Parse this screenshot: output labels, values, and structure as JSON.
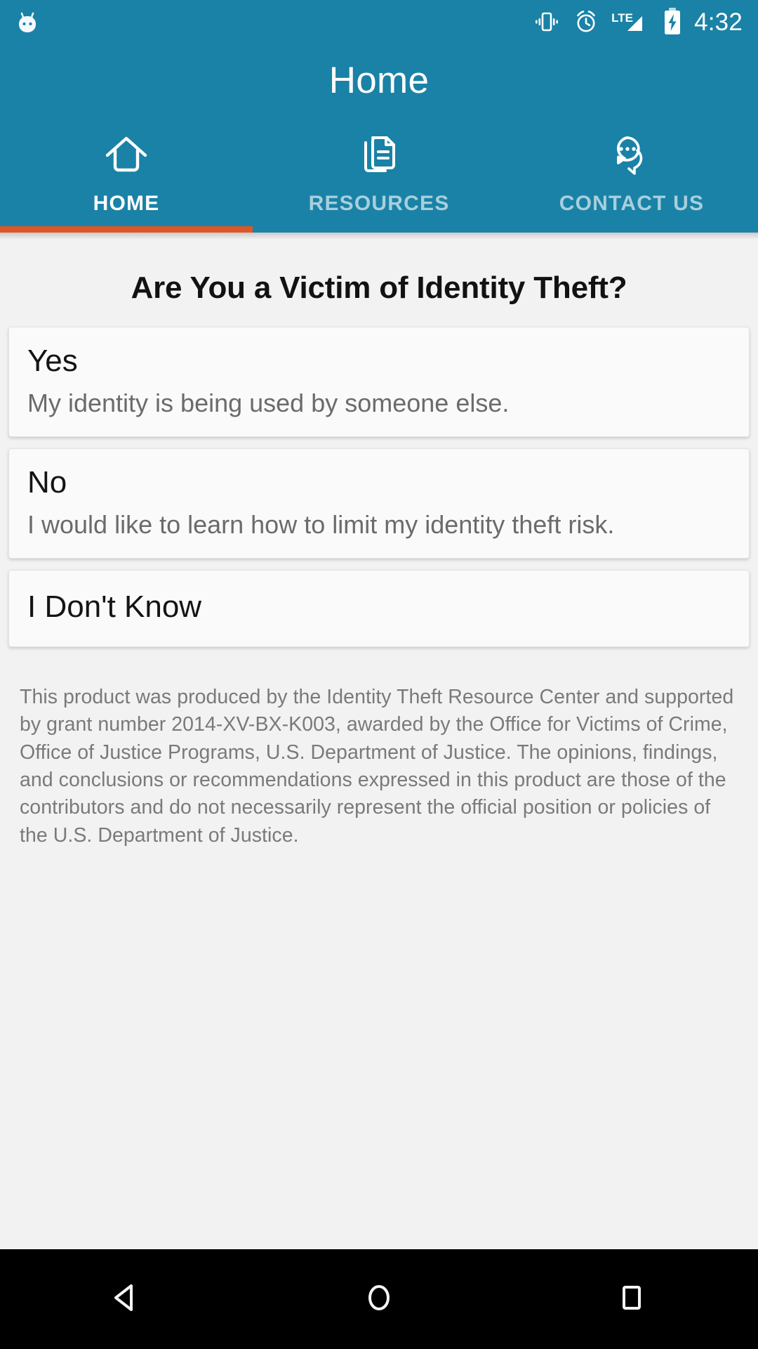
{
  "status_bar": {
    "mascot_icon": "android-mascot-icon",
    "icons": [
      "vibrate-icon",
      "alarm-icon",
      "lte-signal-icon",
      "battery-charging-icon"
    ],
    "network_label": "LTE",
    "clock": "4:32"
  },
  "app_bar": {
    "title": "Home",
    "background_color": "#1A82A6",
    "indicator_color": "#DD5627",
    "tabs": [
      {
        "label": "HOME",
        "icon": "home-icon",
        "active": true
      },
      {
        "label": "RESOURCES",
        "icon": "documents-icon",
        "active": false
      },
      {
        "label": "CONTACT US",
        "icon": "chat-bubbles-icon",
        "active": false
      }
    ]
  },
  "main": {
    "heading": "Are You a Victim of Identity Theft?",
    "options": [
      {
        "title": "Yes",
        "subtitle": "My identity is being used by someone else."
      },
      {
        "title": "No",
        "subtitle": "I would like to learn how to limit my identity theft risk."
      },
      {
        "title": "I Don't Know",
        "subtitle": ""
      }
    ],
    "disclaimer": "This product was produced by the Identity Theft Resource Center and supported by grant number 2014-XV-BX-K003, awarded by the Office for Victims of Crime, Office of Justice Programs, U.S. Department of Justice. The opinions, findings, and conclusions or recommendations expressed in this product are those of the contributors and do not necessarily represent the official position or policies of the U.S. Department of Justice."
  },
  "nav_bar": {
    "buttons": [
      {
        "name": "back-button",
        "icon": "triangle-back-icon"
      },
      {
        "name": "home-button",
        "icon": "circle-home-icon"
      },
      {
        "name": "recents-button",
        "icon": "square-recents-icon"
      }
    ]
  }
}
